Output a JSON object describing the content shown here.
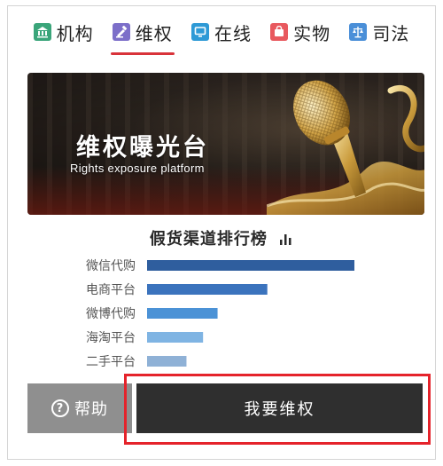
{
  "tabs": [
    {
      "label": "机构",
      "icon": "institution-icon",
      "color": "#3aa57a",
      "active": false
    },
    {
      "label": "维权",
      "icon": "rights-icon",
      "color": "#7c6fc9",
      "active": true
    },
    {
      "label": "在线",
      "icon": "online-icon",
      "color": "#2e9ad6",
      "active": false
    },
    {
      "label": "实物",
      "icon": "product-icon",
      "color": "#e8595e",
      "active": false
    },
    {
      "label": "司法",
      "icon": "justice-icon",
      "color": "#4a8fd8",
      "active": false
    }
  ],
  "banner": {
    "title": "维权曝光台",
    "subtitle": "Rights exposure platform"
  },
  "chart_data": {
    "type": "bar",
    "orientation": "horizontal",
    "title": "假货渠道排行榜",
    "categories": [
      "微信代购",
      "电商平台",
      "微博代购",
      "海淘平台",
      "二手平台"
    ],
    "values": [
      100,
      58,
      34,
      27,
      19
    ],
    "colors": [
      "#2f5e9e",
      "#3b73bd",
      "#4b92d6",
      "#7fb4e3",
      "#8fb1d6"
    ],
    "xlim": [
      0,
      100
    ],
    "grid": false,
    "legend": "none"
  },
  "actions": {
    "help_label": "帮助",
    "help_symbol": "?",
    "primary_label": "我要维权"
  },
  "colors": {
    "accent": "#d9333a",
    "highlight": "#e5232b",
    "primary_button": "#2f2f2f",
    "help_button": "#8f8f8f"
  }
}
